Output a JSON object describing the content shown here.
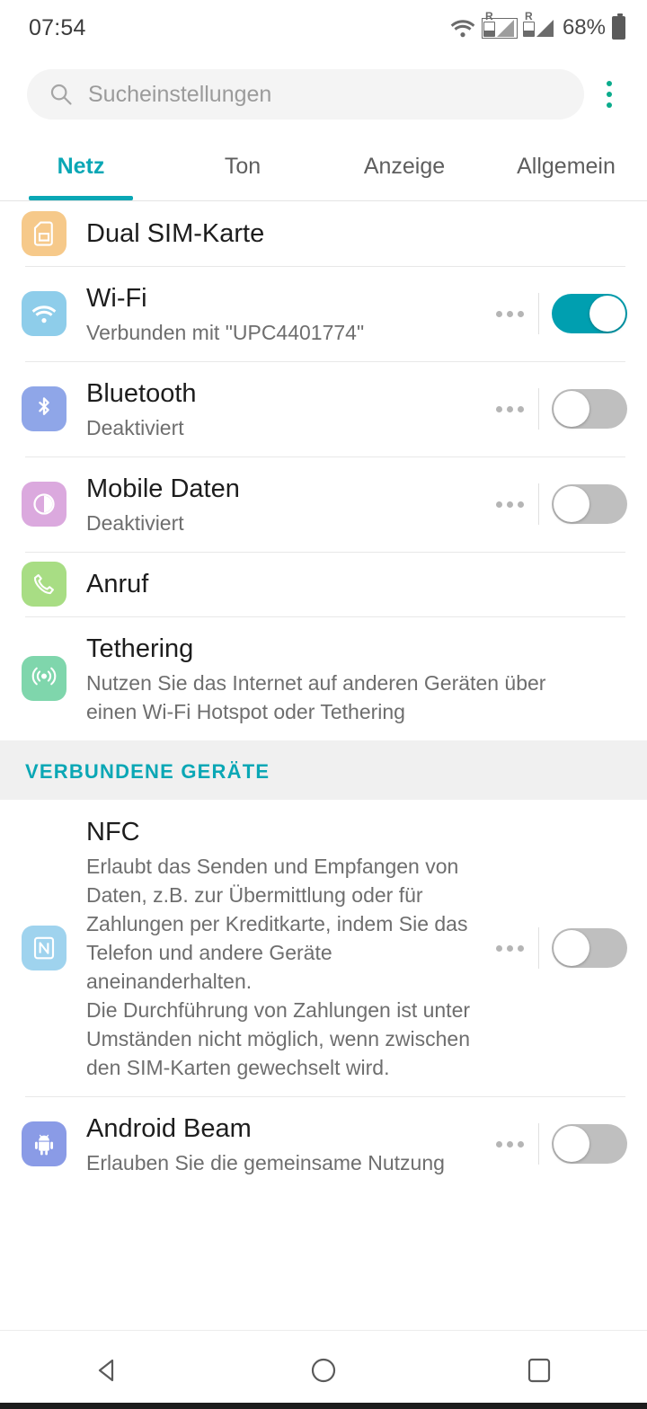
{
  "status_bar": {
    "time": "07:54",
    "wifi_icon": "wifi-icon",
    "sim1_roaming": "R",
    "sim2_roaming": "R",
    "battery_percent": "68%"
  },
  "search": {
    "placeholder": "Sucheinstellungen",
    "icon": "search-icon",
    "overflow_icon": "kebab-menu-icon"
  },
  "tabs": [
    {
      "label": "Netz",
      "active": true
    },
    {
      "label": "Ton",
      "active": false
    },
    {
      "label": "Anzeige",
      "active": false
    },
    {
      "label": "Allgemein",
      "active": false
    }
  ],
  "accent_color": "#0aa7b5",
  "toggle_on_color": "#009fb0",
  "toggle_off_color": "#bfbfbf",
  "network_section": {
    "items": [
      {
        "title": "Dual SIM-Karte",
        "subtitle": "",
        "icon": "sim-card-icon",
        "icon_bg": "#f6c98a",
        "has_toggle": false,
        "has_overflow": false
      },
      {
        "title": "Wi-Fi",
        "subtitle": "Verbunden mit \"UPC4401774\"",
        "icon": "wifi-icon",
        "icon_bg": "#8ecdea",
        "has_toggle": true,
        "toggle_state": "on",
        "has_overflow": true
      },
      {
        "title": "Bluetooth",
        "subtitle": "Deaktiviert",
        "icon": "bluetooth-icon",
        "icon_bg": "#8fa6e8",
        "has_toggle": true,
        "toggle_state": "off",
        "has_overflow": true
      },
      {
        "title": "Mobile Daten",
        "subtitle": "Deaktiviert",
        "icon": "mobile-data-icon",
        "icon_bg": "#dba9de",
        "has_toggle": true,
        "toggle_state": "off",
        "has_overflow": true
      },
      {
        "title": "Anruf",
        "subtitle": "",
        "icon": "phone-icon",
        "icon_bg": "#a8dd84",
        "has_toggle": false,
        "has_overflow": false
      },
      {
        "title": "Tethering",
        "subtitle": "Nutzen Sie das Internet auf anderen Geräten über einen Wi-Fi Hotspot oder Tethering",
        "icon": "hotspot-icon",
        "icon_bg": "#7fd6ac",
        "has_toggle": false,
        "has_overflow": false
      }
    ]
  },
  "connected_devices_section": {
    "header": "VERBUNDENE GERÄTE",
    "items": [
      {
        "title": "NFC",
        "subtitle": "Erlaubt das Senden und Empfangen von Daten, z.B. zur Übermittlung oder für Zahlungen per Kreditkarte, indem Sie das Telefon und andere Geräte aneinanderhalten.\nDie Durchführung von Zahlungen ist unter Umständen nicht möglich, wenn zwischen den SIM-Karten gewechselt wird.",
        "icon": "nfc-icon",
        "icon_bg": "#9fd3ee",
        "has_toggle": true,
        "toggle_state": "off",
        "has_overflow": true
      },
      {
        "title": "Android Beam",
        "subtitle": "Erlauben Sie die gemeinsame Nutzung",
        "icon": "android-robot-icon",
        "icon_bg": "#8a9be6",
        "has_toggle": true,
        "toggle_state": "off",
        "has_overflow": true
      }
    ]
  },
  "nav_bar": {
    "back": "back-triangle-icon",
    "home": "home-circle-icon",
    "recents": "recents-square-icon"
  }
}
